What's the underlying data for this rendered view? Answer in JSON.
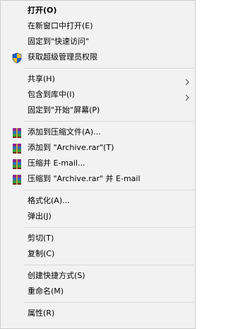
{
  "menu": {
    "items": [
      {
        "label": "打开(O)"
      },
      {
        "label": "在新窗口中打开(E)"
      },
      {
        "label": "固定到\"快速访问\""
      },
      {
        "label": "获取超级管理员权限",
        "icon": "uac-shield-icon"
      },
      {
        "label": "共享(H)"
      },
      {
        "label": "包含到库中(I)"
      },
      {
        "label": "固定到\"开始\"屏幕(P)"
      },
      {
        "label": "添加到压缩文件(A)...",
        "icon": "winrar-icon"
      },
      {
        "label": "添加到 \"Archive.rar\"(T)",
        "icon": "winrar-icon"
      },
      {
        "label": "压缩并 E-mail...",
        "icon": "winrar-icon"
      },
      {
        "label": "压缩到 \"Archive.rar\" 并 E-mail",
        "icon": "winrar-icon"
      },
      {
        "label": "格式化(A)..."
      },
      {
        "label": "弹出(J)"
      },
      {
        "label": "剪切(T)"
      },
      {
        "label": "复制(C)"
      },
      {
        "label": "创建快捷方式(S)"
      },
      {
        "label": "重命名(M)"
      },
      {
        "label": "属性(R)"
      }
    ]
  },
  "colors": {
    "menu_background": "#f2f2f2",
    "menu_border": "#cccccc",
    "separator": "#d7d7d7",
    "text": "#000000"
  }
}
